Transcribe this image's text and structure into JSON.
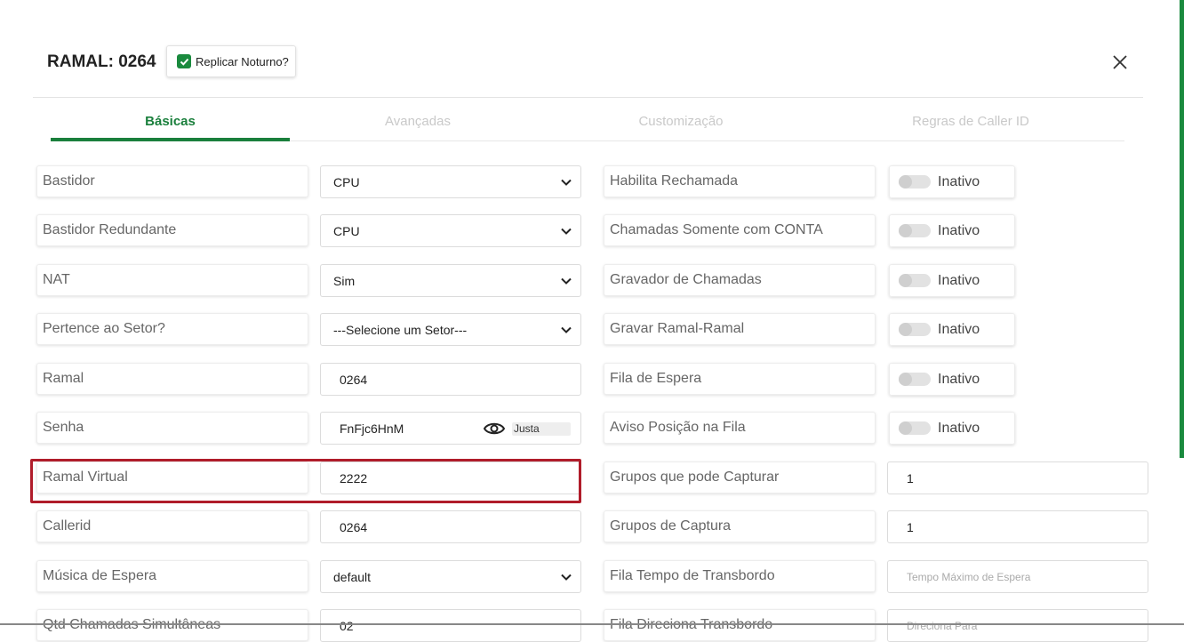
{
  "header": {
    "title": "RAMAL: 0264",
    "replicar_label": "Replicar Noturno?"
  },
  "tabs": [
    {
      "label": "Básicas",
      "active": true
    },
    {
      "label": "Avançadas",
      "active": false
    },
    {
      "label": "Customização",
      "active": false
    },
    {
      "label": "Regras de Caller ID",
      "active": false
    }
  ],
  "left_fields": [
    {
      "label": "Bastidor",
      "value": "CPU",
      "kind": "select"
    },
    {
      "label": "Bastidor Redundante",
      "value": "CPU",
      "kind": "select"
    },
    {
      "label": "NAT",
      "value": "Sim",
      "kind": "select"
    },
    {
      "label": "Pertence ao Setor?",
      "value": "---Selecione um Setor---",
      "kind": "select"
    },
    {
      "label": "Ramal",
      "value": "0264",
      "kind": "input"
    },
    {
      "label": "Senha",
      "value": "FnFjc6HnM",
      "kind": "password",
      "strength": "Justa"
    },
    {
      "label": "Ramal Virtual",
      "value": "2222",
      "kind": "input"
    },
    {
      "label": "Callerid",
      "value": "0264",
      "kind": "input"
    },
    {
      "label": "Música de Espera",
      "value": "default",
      "kind": "select"
    },
    {
      "label": "Qtd Chamadas Simultâneas",
      "value": "02",
      "kind": "input"
    }
  ],
  "right_fields": [
    {
      "label": "Habilita Rechamada",
      "value": "Inativo",
      "kind": "toggle"
    },
    {
      "label": "Chamadas Somente com CONTA",
      "value": "Inativo",
      "kind": "toggle"
    },
    {
      "label": "Gravador de Chamadas",
      "value": "Inativo",
      "kind": "toggle"
    },
    {
      "label": "Gravar Ramal-Ramal",
      "value": "Inativo",
      "kind": "toggle"
    },
    {
      "label": "Fila de Espera",
      "value": "Inativo",
      "kind": "toggle"
    },
    {
      "label": "Aviso Posição na Fila",
      "value": "Inativo",
      "kind": "toggle"
    },
    {
      "label": "Grupos que pode Capturar",
      "value": "1",
      "kind": "input"
    },
    {
      "label": "Grupos de Captura",
      "value": "1",
      "kind": "input"
    },
    {
      "label": "Fila Tempo de Transbordo",
      "placeholder": "Tempo Máximo de Espera",
      "kind": "input"
    },
    {
      "label": "Fila Direciona Transbordo",
      "placeholder": "Direciona Para",
      "kind": "input"
    }
  ],
  "colors": {
    "accent": "#1a7f3c",
    "highlight": "#b01c2a"
  }
}
